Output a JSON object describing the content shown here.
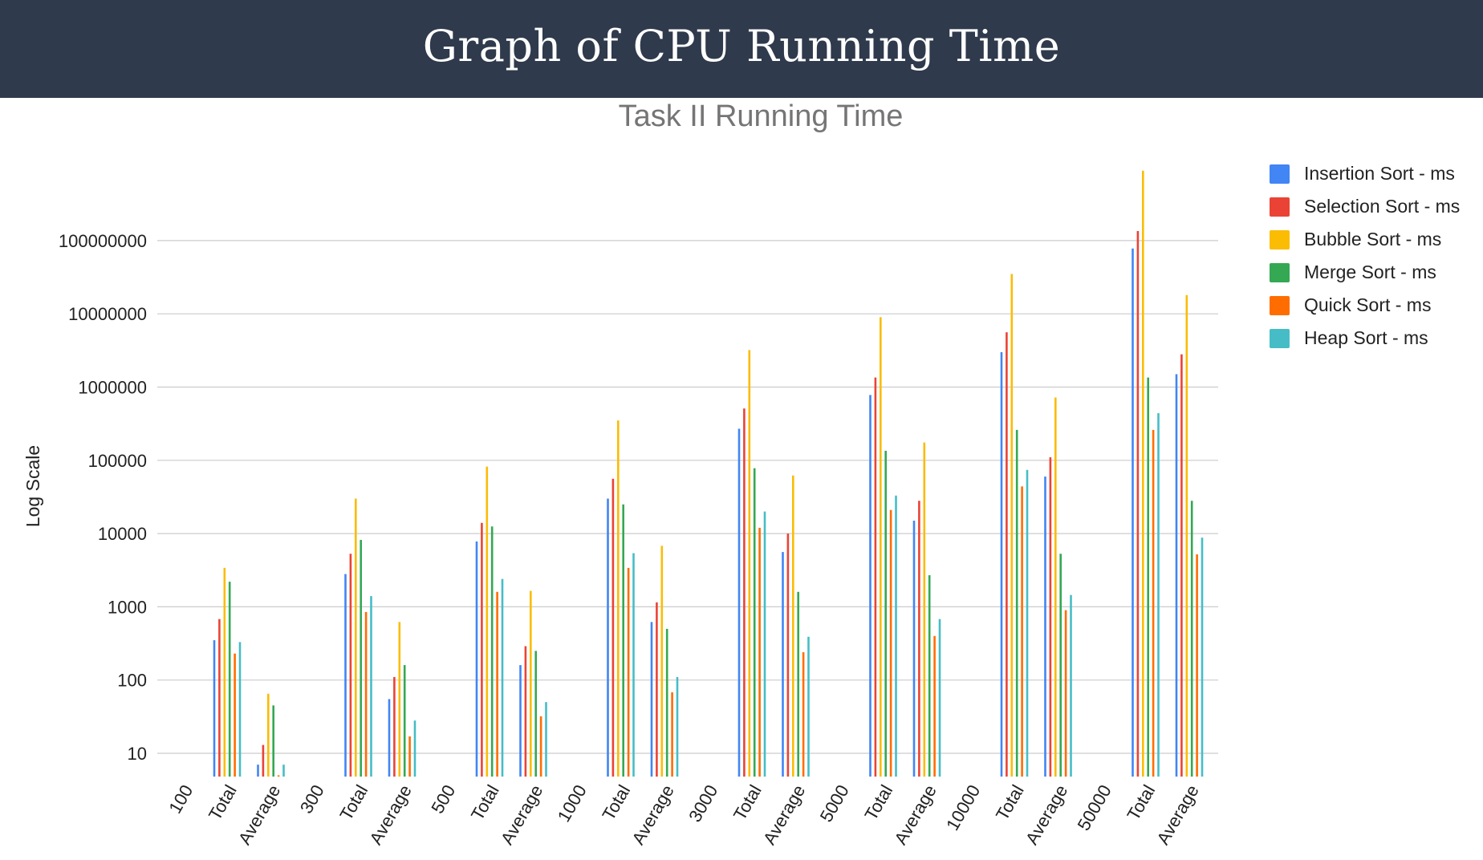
{
  "header": {
    "title": "Graph of CPU Running Time"
  },
  "chart_data": {
    "type": "bar",
    "title": "Task II Running Time",
    "xlabel": "",
    "ylabel": "Log Scale",
    "yscale": "log",
    "ylim": [
      5,
      1000000000
    ],
    "yticks": [
      "10",
      "100",
      "1000",
      "10000",
      "100000",
      "1000000",
      "10000000",
      "100000000"
    ],
    "ytick_values": [
      10,
      100,
      1000,
      10000,
      100000,
      1000000,
      10000000,
      100000000
    ],
    "grid": true,
    "legend_position": "right",
    "categories": [
      "100",
      "Total",
      "Average",
      "300",
      "Total",
      "Average",
      "500",
      "Total",
      "Average",
      "1000",
      "Total",
      "Average",
      "3000",
      "Total",
      "Average",
      "5000",
      "Total",
      "Average",
      "10000",
      "Total",
      "Average",
      "50000",
      "Total",
      "Average"
    ],
    "series": [
      {
        "name": "Insertion Sort - ms",
        "color": "#4285f4",
        "values": [
          null,
          350,
          7,
          null,
          2800,
          55,
          null,
          7800,
          160,
          null,
          30000,
          620,
          null,
          270000,
          5600,
          null,
          780000,
          15000,
          null,
          3000000,
          60000,
          null,
          78000000,
          1500000
        ]
      },
      {
        "name": "Selection Sort - ms",
        "color": "#ea4335",
        "values": [
          null,
          680,
          13,
          null,
          5300,
          110,
          null,
          14000,
          290,
          null,
          56000,
          1150,
          null,
          510000,
          10000,
          null,
          1350000,
          28000,
          null,
          5600000,
          110000,
          null,
          135000000,
          2800000
        ]
      },
      {
        "name": "Bubble Sort - ms",
        "color": "#fbbc04",
        "values": [
          null,
          3400,
          65,
          null,
          30000,
          620,
          null,
          82000,
          1650,
          null,
          350000,
          6800,
          null,
          3200000,
          62000,
          null,
          9000000,
          175000,
          null,
          35000000,
          720000,
          null,
          900000000,
          18000000
        ]
      },
      {
        "name": "Merge Sort - ms",
        "color": "#34a853",
        "values": [
          null,
          2200,
          45,
          null,
          8200,
          160,
          null,
          12500,
          250,
          null,
          25000,
          500,
          null,
          78000,
          1600,
          null,
          135000,
          2700,
          null,
          260000,
          5300,
          null,
          1350000,
          28000
        ]
      },
      {
        "name": "Quick Sort - ms",
        "color": "#ff6d01",
        "values": [
          null,
          230,
          5,
          null,
          850,
          17,
          null,
          1600,
          32,
          null,
          3400,
          68,
          null,
          12000,
          240,
          null,
          21000,
          400,
          null,
          44000,
          900,
          null,
          260000,
          5200
        ]
      },
      {
        "name": "Heap Sort - ms",
        "color": "#46bdc6",
        "values": [
          null,
          330,
          7,
          null,
          1400,
          28,
          null,
          2400,
          50,
          null,
          5400,
          110,
          null,
          20000,
          390,
          null,
          33000,
          680,
          null,
          74000,
          1450,
          null,
          440000,
          8800
        ]
      }
    ]
  }
}
